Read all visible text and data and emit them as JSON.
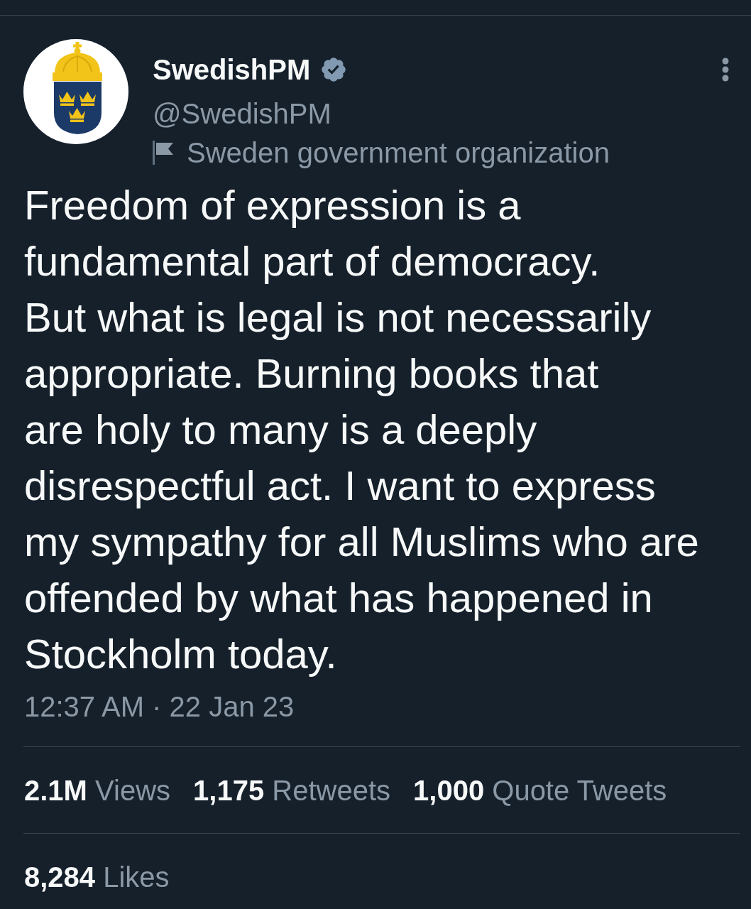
{
  "tweet": {
    "author": {
      "name": "SwedishPM",
      "verified": true,
      "handle": "@SwedishPM",
      "affiliation": "Sweden government organization"
    },
    "text_lines": [
      "Freedom of expression is a",
      "fundamental part of democracy.",
      "But what is legal is not necessarily",
      "appropriate. Burning books that",
      "are holy to many is a deeply",
      "disrespectful act. I want to express",
      "my sympathy for all Muslims who are",
      "offended by what has happened in",
      "Stockholm today."
    ],
    "timestamp": "12:37 AM · 22 Jan 23",
    "stat_rows": [
      {
        "stats": [
          {
            "count": "2.1M",
            "label": "Views"
          },
          {
            "count": "1,175",
            "label": "Retweets"
          },
          {
            "count": "1,000",
            "label": "Quote Tweets"
          }
        ]
      },
      {
        "stats": [
          {
            "count": "8,284",
            "label": "Likes"
          }
        ]
      }
    ]
  }
}
